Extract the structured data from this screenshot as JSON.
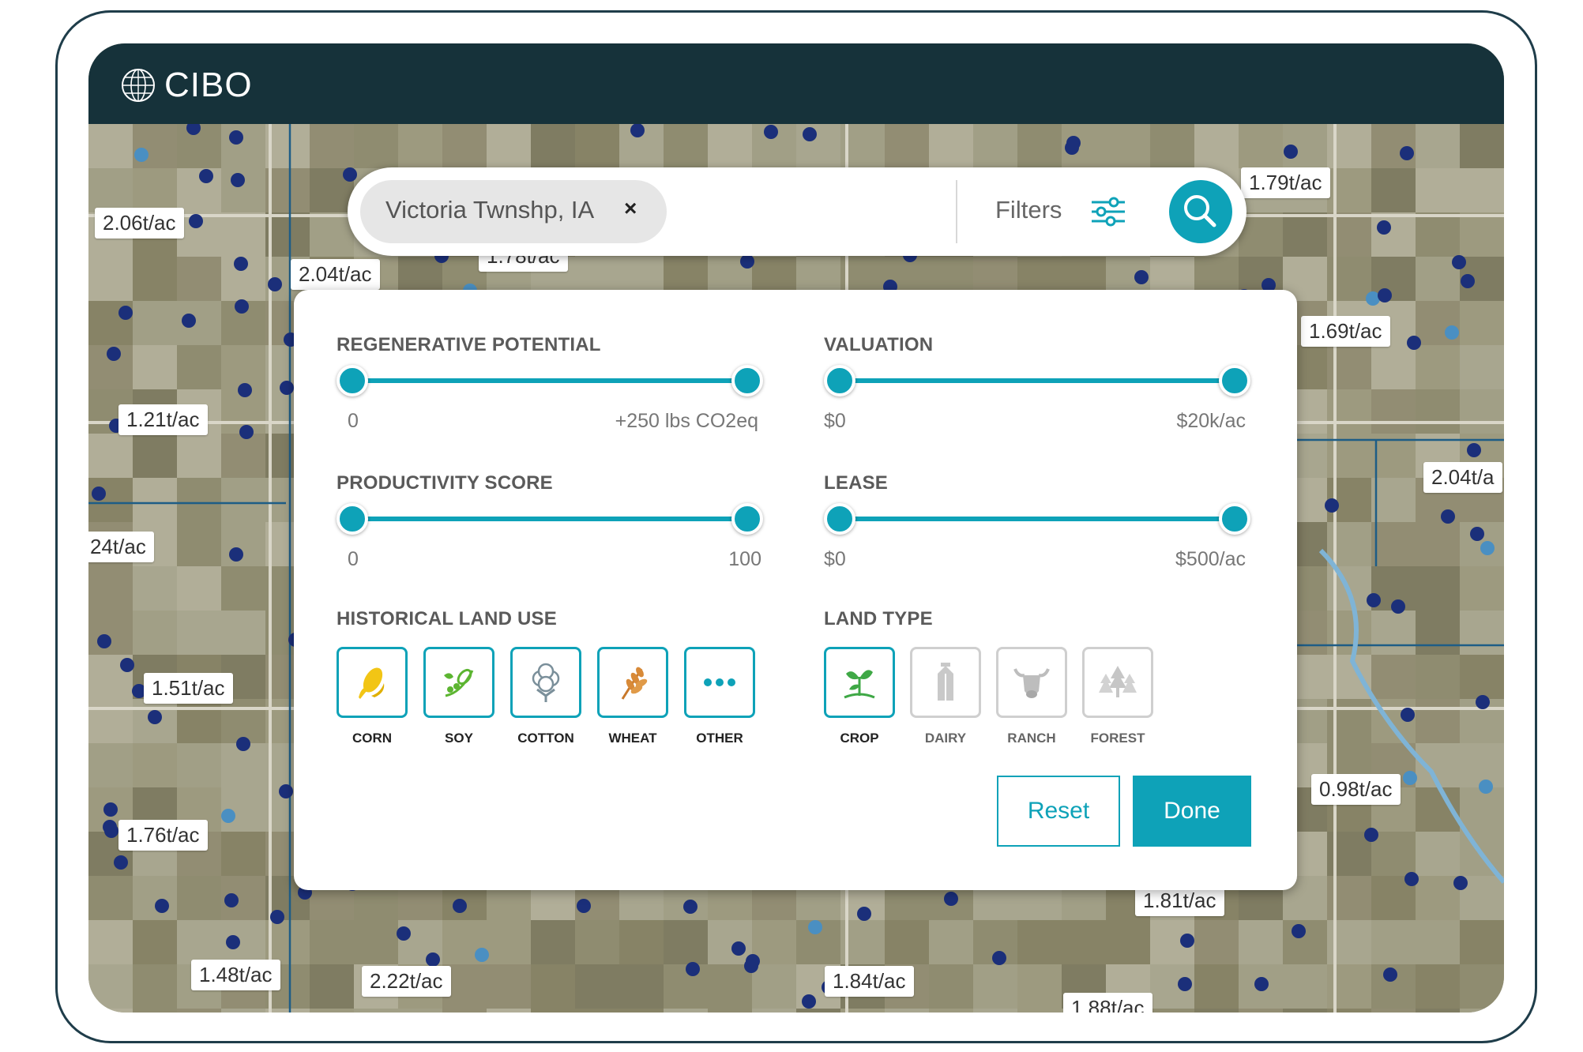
{
  "app": {
    "brand": "CIBO"
  },
  "search": {
    "location": "Victoria Twnshp, IA",
    "clear_symbol": "×",
    "filters_label": "Filters"
  },
  "map": {
    "yield_labels": [
      "2.06t/ac",
      "2.04t/ac",
      "1.79t/ac",
      "1.69t/ac",
      "1.21t/ac",
      "2.04t/a",
      "24t/ac",
      "1.51t/ac",
      "1.76t/ac",
      "0.98t/ac",
      "1.48t/ac",
      "2.22t/ac",
      "1.84t/ac",
      "1.81t/ac",
      "1.88t/ac",
      "1.78t/ac"
    ]
  },
  "filters": {
    "regenerative_potential": {
      "title": "REGENERATIVE POTENTIAL",
      "min_label": "0",
      "max_label": "+250 lbs CO2eq",
      "low": 0,
      "high": 1
    },
    "valuation": {
      "title": "VALUATION",
      "min_label": "$0",
      "max_label": "$20k/ac",
      "low": 0,
      "high": 1
    },
    "productivity_score": {
      "title": "PRODUCTIVITY SCORE",
      "min_label": "0",
      "max_label": "100",
      "low": 0,
      "high": 1
    },
    "lease": {
      "title": "LEASE",
      "min_label": "$0",
      "max_label": "$500/ac",
      "low": 0,
      "high": 1
    },
    "historical_land_use": {
      "title": "HISTORICAL LAND USE",
      "options": [
        {
          "label": "CORN",
          "icon": "corn-icon",
          "selected": true
        },
        {
          "label": "SOY",
          "icon": "soy-icon",
          "selected": true
        },
        {
          "label": "COTTON",
          "icon": "cotton-icon",
          "selected": true
        },
        {
          "label": "WHEAT",
          "icon": "wheat-icon",
          "selected": true
        },
        {
          "label": "OTHER",
          "icon": "more-dots-icon",
          "selected": true
        }
      ]
    },
    "land_type": {
      "title": "LAND TYPE",
      "options": [
        {
          "label": "CROP",
          "icon": "plant-icon",
          "selected": true
        },
        {
          "label": "DAIRY",
          "icon": "milk-carton-icon",
          "selected": false
        },
        {
          "label": "RANCH",
          "icon": "bull-icon",
          "selected": false
        },
        {
          "label": "FOREST",
          "icon": "trees-icon",
          "selected": false
        }
      ]
    }
  },
  "actions": {
    "reset_label": "Reset",
    "done_label": "Done"
  },
  "colors": {
    "accent": "#0ea2b8",
    "topbar": "#16323a",
    "frame": "#1f3d4a",
    "marker": "#1b2f7a"
  }
}
